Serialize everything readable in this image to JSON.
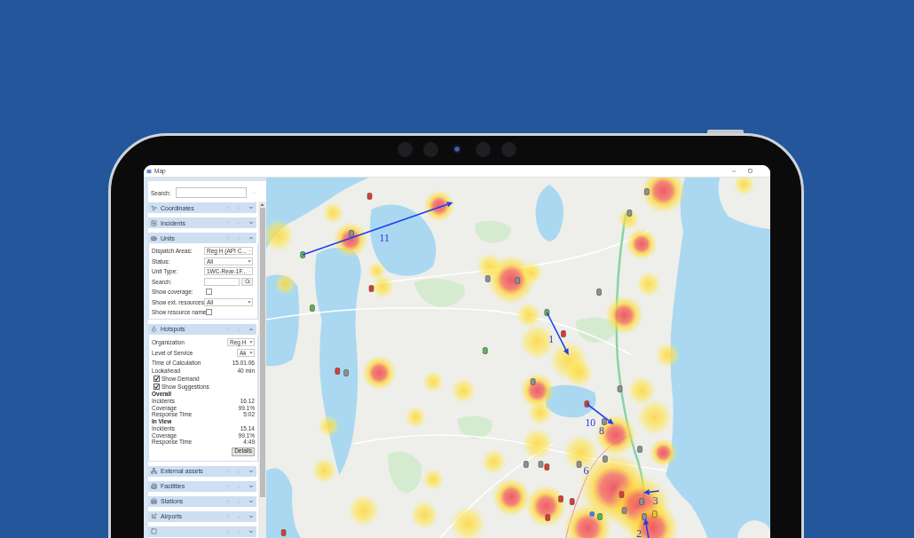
{
  "window": {
    "title": "Map"
  },
  "sidebar": {
    "search": {
      "label": "Search:"
    },
    "sections": [
      {
        "label": "Coordinates",
        "expanded": false
      },
      {
        "label": "Incidents",
        "expanded": false
      },
      {
        "label": "Units",
        "expanded": true,
        "fields": [
          {
            "kind": "select",
            "label": "Dispatch Areas:",
            "value": "Reg H (API C..."
          },
          {
            "kind": "select",
            "label": "Status:",
            "value": "All"
          },
          {
            "kind": "select",
            "label": "Unit Type:",
            "value": "1WC-Rear-1F..."
          },
          {
            "kind": "search",
            "label": "Search:"
          },
          {
            "kind": "checkbox",
            "label": "Show coverage:",
            "checked": false
          },
          {
            "kind": "select",
            "label": "Show ext. resources:",
            "value": "All"
          },
          {
            "kind": "checkbox",
            "label": "Show resource name:",
            "checked": false
          }
        ]
      },
      {
        "label": "Hotspots",
        "expanded": true,
        "rows": [
          {
            "kind": "select",
            "label": "Organization",
            "value": "Reg H"
          },
          {
            "kind": "select",
            "label": "Level of Service",
            "value": "Ak"
          },
          {
            "kind": "value",
            "label": "Time of Calculation",
            "value": "15.01.06"
          },
          {
            "kind": "value",
            "label": "Lookahead",
            "value": "40 min"
          },
          {
            "kind": "checkbox",
            "label": "Show Demand",
            "checked": true
          },
          {
            "kind": "checkbox",
            "label": "Show Suggestions",
            "checked": true
          },
          {
            "kind": "heading",
            "label": "Overall"
          },
          {
            "kind": "stat",
            "label": "Incidents",
            "value": "16.12"
          },
          {
            "kind": "stat",
            "label": "Coverage",
            "value": "99.1%"
          },
          {
            "kind": "stat",
            "label": "Response Time",
            "value": "5:02"
          },
          {
            "kind": "heading",
            "label": "In View"
          },
          {
            "kind": "stat",
            "label": "Incidents",
            "value": "15.14"
          },
          {
            "kind": "stat",
            "label": "Coverage",
            "value": "99.1%"
          },
          {
            "kind": "stat",
            "label": "Response Time",
            "value": "4:49"
          },
          {
            "kind": "button",
            "label": "Details"
          }
        ]
      },
      {
        "label": "External assets",
        "expanded": false
      },
      {
        "label": "Facilities",
        "expanded": false
      },
      {
        "label": "Stations",
        "expanded": false
      },
      {
        "label": "Airports",
        "expanded": false
      },
      {
        "expanded": false
      }
    ]
  },
  "map": {
    "routes": [
      {
        "label": "11"
      },
      {
        "label": "1"
      },
      {
        "label": "10"
      },
      {
        "label": "8"
      },
      {
        "label": "6"
      },
      {
        "label": "2"
      },
      {
        "label": "3"
      }
    ]
  }
}
